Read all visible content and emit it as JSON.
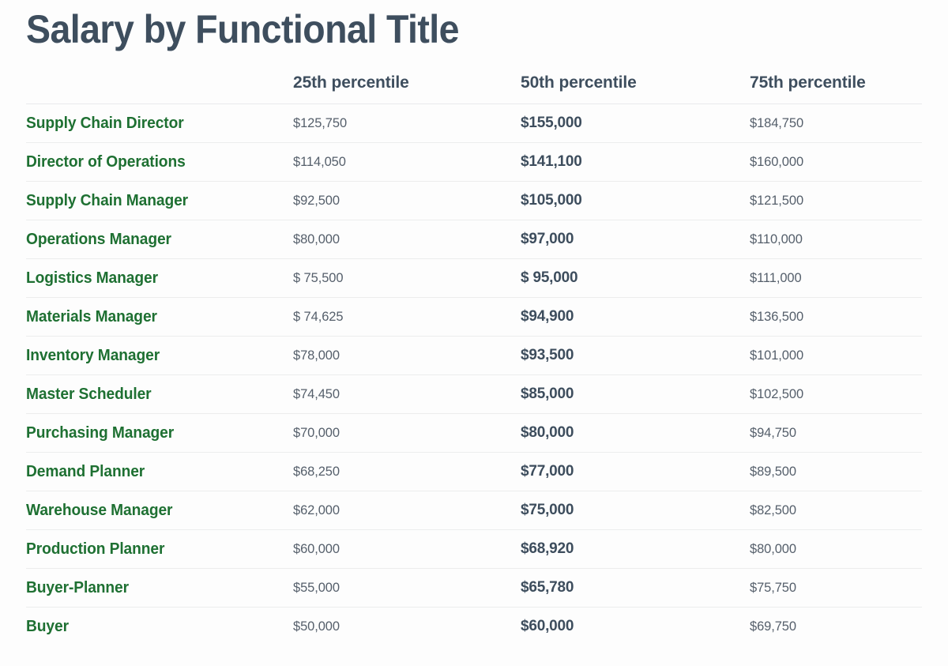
{
  "page": {
    "title": "Salary by Functional Title",
    "background_color": "#fdfdfd",
    "title_color": "#3e4e5e",
    "job_title_color": "#1e7032",
    "median_color": "#3d4d5d",
    "value_color": "#555f6b",
    "divider_color": "#eceded"
  },
  "table": {
    "columns": [
      {
        "key": "title",
        "label": ""
      },
      {
        "key": "p25",
        "label": "25th percentile"
      },
      {
        "key": "p50",
        "label": "50th percentile"
      },
      {
        "key": "p75",
        "label": "75th percentile"
      }
    ],
    "rows": [
      {
        "title": "Supply Chain Director",
        "p25": "$125,750",
        "p50": "$155,000",
        "p75": "$184,750"
      },
      {
        "title": "Director of Operations",
        "p25": "$114,050",
        "p50": "$141,100",
        "p75": "$160,000"
      },
      {
        "title": "Supply Chain Manager",
        "p25": "$92,500",
        "p50": "$105,000",
        "p75": "$121,500"
      },
      {
        "title": "Operations Manager",
        "p25": "$80,000",
        "p50": "$97,000",
        "p75": "$110,000"
      },
      {
        "title": "Logistics Manager",
        "p25": "$ 75,500",
        "p50": "$ 95,000",
        "p75": "$111,000"
      },
      {
        "title": "Materials Manager",
        "p25": "$ 74,625",
        "p50": "$94,900",
        "p75": "$136,500"
      },
      {
        "title": "Inventory Manager",
        "p25": "$78,000",
        "p50": "$93,500",
        "p75": "$101,000"
      },
      {
        "title": "Master Scheduler",
        "p25": "$74,450",
        "p50": "$85,000",
        "p75": "$102,500"
      },
      {
        "title": "Purchasing Manager",
        "p25": "$70,000",
        "p50": "$80,000",
        "p75": "$94,750"
      },
      {
        "title": "Demand Planner",
        "p25": "$68,250",
        "p50": "$77,000",
        "p75": "$89,500"
      },
      {
        "title": "Warehouse Manager",
        "p25": "$62,000",
        "p50": "$75,000",
        "p75": "$82,500"
      },
      {
        "title": "Production Planner",
        "p25": "$60,000",
        "p50": "$68,920",
        "p75": "$80,000"
      },
      {
        "title": "Buyer-Planner",
        "p25": "$55,000",
        "p50": "$65,780",
        "p75": "$75,750"
      },
      {
        "title": "Buyer",
        "p25": "$50,000",
        "p50": "$60,000",
        "p75": "$69,750"
      }
    ]
  },
  "chart_data": {
    "type": "table",
    "title": "Salary by Functional Title",
    "xlabel": "",
    "ylabel": "",
    "categories": [
      "Supply Chain Director",
      "Director of Operations",
      "Supply Chain Manager",
      "Operations Manager",
      "Logistics Manager",
      "Materials Manager",
      "Inventory Manager",
      "Master Scheduler",
      "Purchasing Manager",
      "Demand Planner",
      "Warehouse Manager",
      "Production Planner",
      "Buyer-Planner",
      "Buyer"
    ],
    "series": [
      {
        "name": "25th percentile",
        "values": [
          125750,
          114050,
          92500,
          80000,
          75500,
          74625,
          78000,
          74450,
          70000,
          68250,
          62000,
          60000,
          55000,
          50000
        ]
      },
      {
        "name": "50th percentile",
        "values": [
          155000,
          141100,
          105000,
          97000,
          95000,
          94900,
          93500,
          85000,
          80000,
          77000,
          75000,
          68920,
          65780,
          60000
        ]
      },
      {
        "name": "75th percentile",
        "values": [
          184750,
          160000,
          121500,
          110000,
          111000,
          136500,
          101000,
          102500,
          94750,
          89500,
          82500,
          80000,
          75750,
          69750
        ]
      }
    ],
    "units": "USD",
    "grid": false,
    "legend": "column-headers"
  }
}
